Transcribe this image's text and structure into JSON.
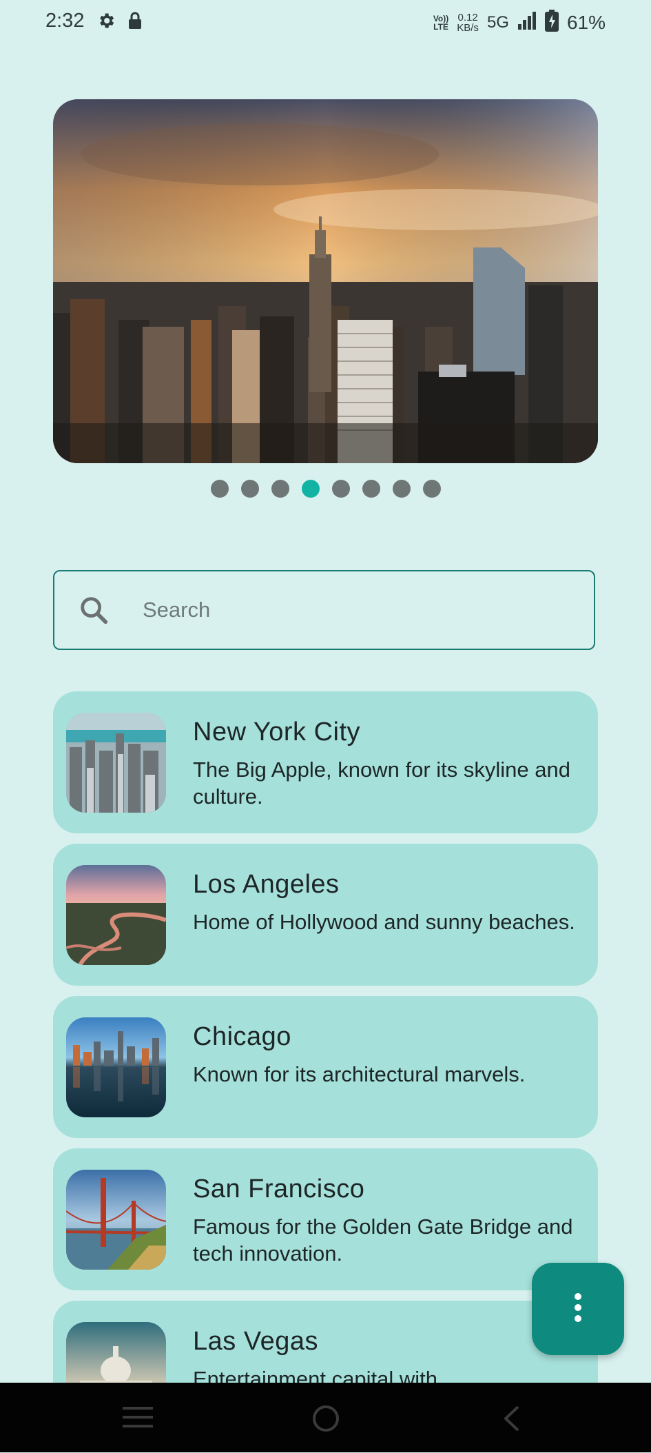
{
  "status": {
    "time": "2:32",
    "volte_top": "Vo))",
    "volte_bottom": "LTE",
    "speed_value": "0.12",
    "speed_unit": "KB/s",
    "network": "5G",
    "battery": "61%"
  },
  "carousel": {
    "count": 8,
    "active_index": 3
  },
  "search": {
    "placeholder": "Search",
    "value": ""
  },
  "cities": [
    {
      "name": "New York City",
      "description": "The Big Apple, known for its skyline and culture."
    },
    {
      "name": "Los Angeles",
      "description": "Home of Hollywood and sunny beaches."
    },
    {
      "name": "Chicago",
      "description": "Known for its architectural marvels."
    },
    {
      "name": "San Francisco",
      "description": "Famous for the Golden Gate Bridge and tech innovation."
    },
    {
      "name": "Las Vegas",
      "description": "Entertainment capital with"
    }
  ],
  "colors": {
    "accent": "#12b3a3",
    "card": "#a6e0da",
    "background": "#d8f1ef",
    "fab": "#0f8a7f"
  },
  "icons": {
    "fab": "more-vert-icon",
    "search": "search-icon",
    "nav": [
      "menu-icon",
      "home-icon",
      "back-icon"
    ]
  }
}
